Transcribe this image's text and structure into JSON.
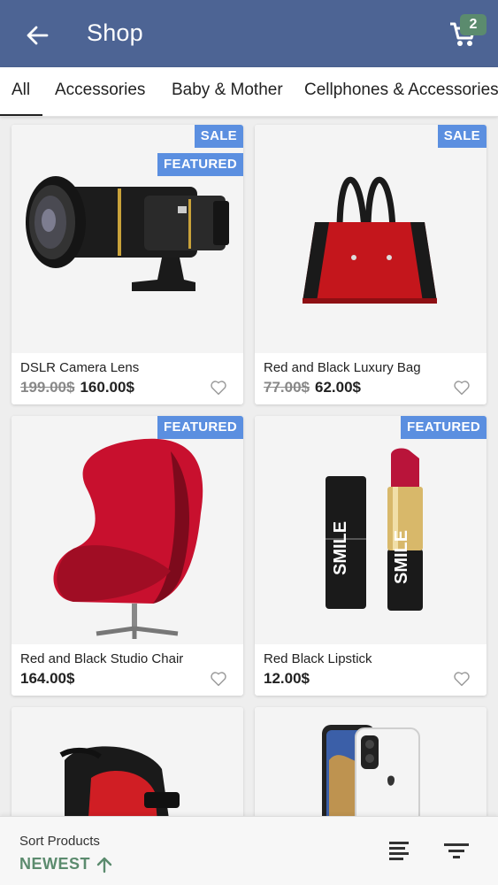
{
  "appbar": {
    "title": "Shop",
    "cart_count": "2",
    "color": "#4d6494"
  },
  "tabs": [
    {
      "label": "All"
    },
    {
      "label": "Accessories"
    },
    {
      "label": "Baby & Mother"
    },
    {
      "label": "Cellphones & Accessories"
    }
  ],
  "products": [
    {
      "name": "DSLR Camera Lens",
      "old_price": "199.00$",
      "price": "160.00$",
      "badges": [
        "SALE",
        "FEATURED"
      ],
      "image": "camera-lens"
    },
    {
      "name": "Red and Black Luxury Bag",
      "old_price": "77.00$",
      "price": "62.00$",
      "badges": [
        "SALE"
      ],
      "image": "handbag"
    },
    {
      "name": "Red and Black Studio Chair",
      "old_price": "",
      "price": "164.00$",
      "badges": [
        "FEATURED"
      ],
      "image": "egg-chair"
    },
    {
      "name": "Red Black Lipstick",
      "old_price": "",
      "price": "12.00$",
      "badges": [
        "FEATURED"
      ],
      "image": "lipstick",
      "lipstick_text": "SMILE"
    },
    {
      "name": "",
      "image": "stroller"
    },
    {
      "name": "",
      "image": "smartphone"
    }
  ],
  "sort": {
    "label": "Sort Products",
    "value": "NEWEST",
    "accent": "#5b8b6e"
  },
  "colors": {
    "badge": "#5b8fe0"
  }
}
